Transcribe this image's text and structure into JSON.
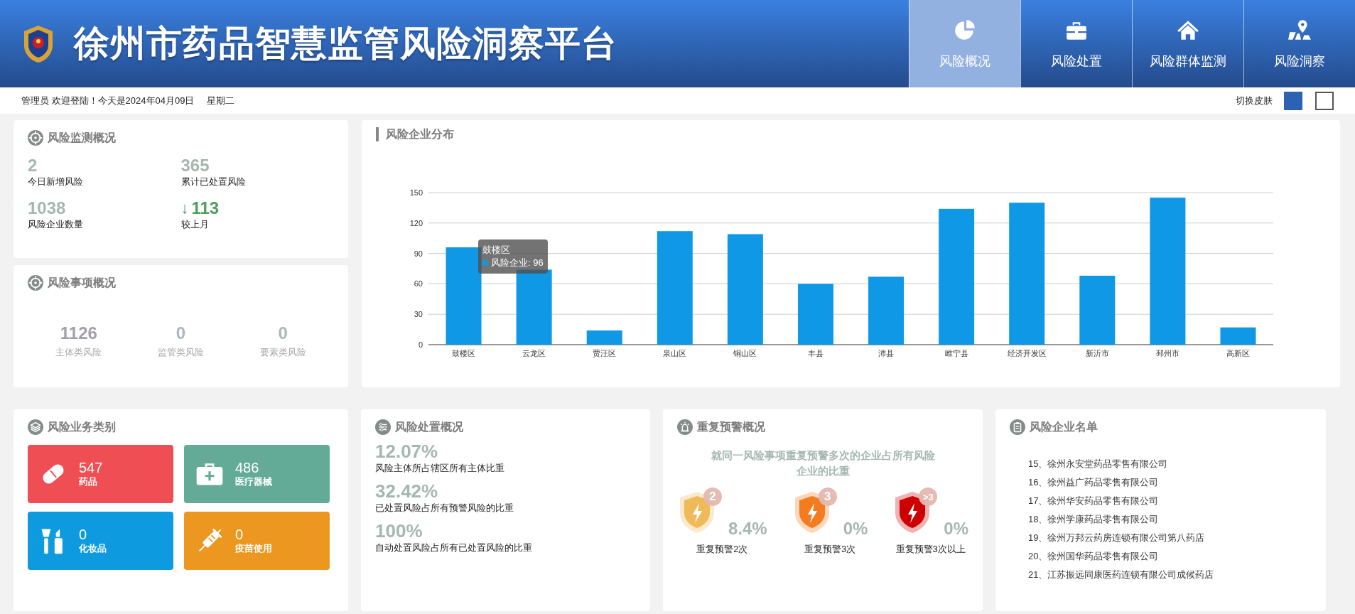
{
  "header": {
    "title": "徐州市药品智慧监管风险洞察平台",
    "nav": [
      {
        "label": "风险概况",
        "kind": "pie",
        "selected": true
      },
      {
        "label": "风险处置",
        "kind": "briefcase",
        "selected": false
      },
      {
        "label": "风险群体监测",
        "kind": "house",
        "selected": false
      },
      {
        "label": "风险洞察",
        "kind": "map",
        "selected": false
      }
    ]
  },
  "subbar": {
    "user": "管理员 欢迎登陆！今天是2024年04月09日",
    "weekday": "星期二",
    "skin_label": "切换皮肤",
    "skins": [
      {
        "color": "#2d62b3"
      },
      {
        "color": "#ffffff"
      }
    ]
  },
  "monitor": {
    "title": "风险监测概况",
    "items": [
      {
        "value": "2",
        "label": "今日新增风险"
      },
      {
        "value": "365",
        "label": "累计已处置风险"
      },
      {
        "value": "1038",
        "label": "风险企业数量"
      },
      {
        "value": "113",
        "label": "较上月",
        "arrow": "↓"
      }
    ]
  },
  "matters": {
    "title": "风险事项概况",
    "items": [
      {
        "value": "1126",
        "label": "主体类风险",
        "color": "#a39eab"
      },
      {
        "value": "0",
        "label": "监管类风险",
        "color": "#a9b5c2"
      },
      {
        "value": "0",
        "label": "要素类风险",
        "color": "#a7b9b0"
      }
    ]
  },
  "distribution": {
    "title": "风险企业分布",
    "tooltip": {
      "title": "鼓楼区",
      "separator": ":",
      "value": "96"
    },
    "chart_data": {
      "type": "bar",
      "categories": [
        "鼓楼区",
        "云龙区",
        "贾汪区",
        "泉山区",
        "铜山区",
        "丰县",
        "沛县",
        "睢宁县",
        "经济开发区",
        "新沂市",
        "邳州市",
        "高新区"
      ],
      "series": [
        {
          "name": "风险企业",
          "color": "#0e98e5",
          "values": [
            96,
            74,
            14,
            112,
            109,
            60,
            67,
            134,
            140,
            68,
            145,
            17
          ]
        }
      ],
      "grid": true,
      "ylim": [
        0,
        150
      ],
      "yticks": [
        0,
        30,
        60,
        90,
        120,
        150
      ]
    }
  },
  "business": {
    "title": "风险业务类别",
    "tiles": [
      {
        "kind": "drug",
        "value": "547",
        "label": "药品",
        "color": "#ef4e54"
      },
      {
        "kind": "device",
        "value": "486",
        "label": "医疗器械",
        "color": "#63ab96"
      },
      {
        "kind": "cosmetic",
        "value": "0",
        "label": "化妆品",
        "color": "#0e9ade"
      },
      {
        "kind": "vaccine",
        "value": "0",
        "label": "疫苗使用",
        "color": "#ec9720"
      }
    ]
  },
  "disposal": {
    "title": "风险处置概况",
    "items": [
      {
        "value": "12.07%",
        "label": "风险主体所占辖区所有主体比重"
      },
      {
        "value": "32.42%",
        "label": "已处置风险占所有预警风险的比重"
      },
      {
        "value": "100%",
        "label": "自动处置风险占所有已处置风险的比重"
      }
    ]
  },
  "repeat": {
    "title": "重复预警概况",
    "subtitle": "就同一风险事项重复预警多次的企业占所有风险企业的比重",
    "items": [
      {
        "badge": "2",
        "value": "8.4%",
        "label": "重复预警2次",
        "color": "#f0b95a"
      },
      {
        "badge": "3",
        "value": "0%",
        "label": "重复预警3次",
        "color": "#f47c20"
      },
      {
        "badge": ">3",
        "value": "0%",
        "label": "重复预警3次以上",
        "color": "#cc0000"
      }
    ]
  },
  "companies": {
    "title": "风险企业名单",
    "items": [
      "15、徐州永安堂药品零售有限公司",
      "16、徐州益广药品零售有限公司",
      "17、徐州华安药品零售有限公司",
      "18、徐州学康药品零售有限公司",
      "19、徐州万邦云药房连锁有限公司第八药店",
      "20、徐州国华药品零售有限公司",
      "21、江苏振远同康医药连锁有限公司成候药店"
    ]
  }
}
